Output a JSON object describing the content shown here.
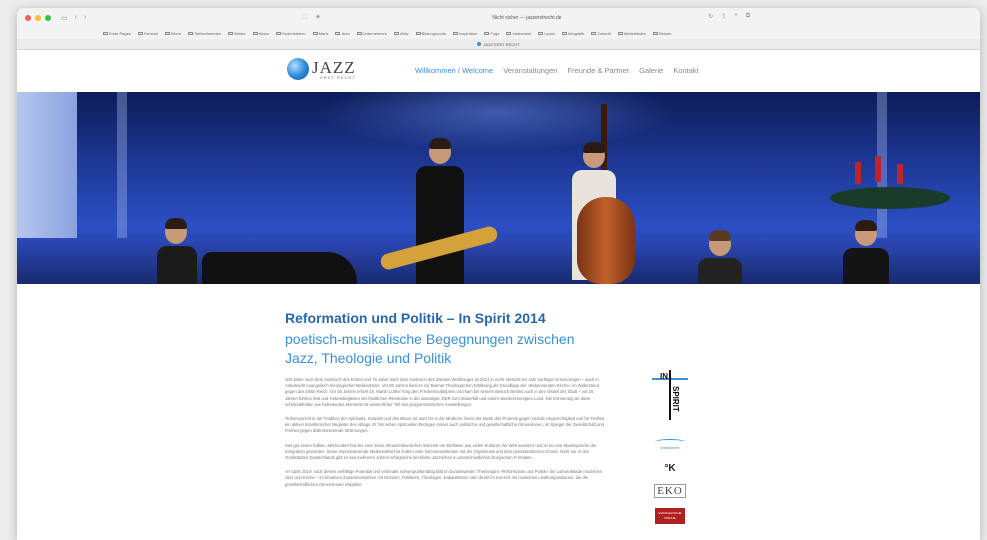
{
  "browser": {
    "address": "Nicht sicher — jazzerstrecht.de",
    "tab_title": "JAZZ ERST RECHT",
    "bookmarks": [
      "Erste Pages",
      "Fahrrad",
      "Eltern",
      "Stellenfremden",
      "Werke",
      "News",
      "Gedenkfeiern",
      "Marix",
      "Auto",
      "Unternehmen",
      "Aktiv",
      "Bildungsrouts",
      "Inspiration",
      "Fuge",
      "Instrument",
      "Lyons",
      "Infografik",
      "Zukunft",
      "Weiterbilden",
      "Reisen"
    ]
  },
  "site": {
    "logo_text": "JAZZ",
    "logo_sub": "ERST RECHT",
    "nav": [
      "Willkommen / Welcome",
      "Veranstaltungen",
      "Freunde & Partner",
      "Galerie",
      "Kontakt"
    ]
  },
  "article": {
    "title": "Reformation und Politik – In Spirit 2014",
    "subtitle": "poetisch-musikalische Begegnungen zwischen Jazz, Theologie und Politik",
    "paragraphs": [
      "100 Jahre nach dem Ausbruch des Ersten und 75 Jahre nach dem Ausbruch des Zweiten Weltkrieges ist 2014 in mehr Hinsicht ein Jahr wichtiger Erinnerungen – auch in Anbetracht evangelisch-theologischer Meilensteine. Vor 80 Jahren kam es zur Barmer Theologischen Erklärung als Grundlage der «Bekennenden Kirche» im Widerstand gegen das Dritte Reich. Vor 50 Jahren erhielt Dr. Martin Luther King den Friedensnobelpreis und kam bei seinem Besuch Berlins auch in den Ostteil der Stadt – vor 25 Jahren führten Mut und Gebetsbegleiten der friedlichen Revolution in der damaligen DDR zum Mauerfall und einem wiedervereinigten Land. Die Erinnerung an diese schicksalhaften wie befreienden Momente ist wesentlicher Teil des programmatischen Ausstellungen.",
      "Tiefverwurzelt in der Tradition der Spirituals, Gospels und des Blues, ist Jazz bis in die Moderne hinein als Musik des Protests gegen soziale Ungerechtigkeit und für Freiheit ein aktiver künstlerischer Begleiter des Alltags. Er hat neben spirituellen Bezügen immer auch politische und gesellschaftliche Dimensionen, ist Spiegel der Gesellschaft und Freiheit gegen diskriminierende Strömungen.",
      "Seit gut einem halben Jahrhundert hat der Jazz seine afroamerikanischen Wurzeln um Einflüsse aus vielen Kulturen der Welt erweitert und ist so eine Musiksprache der Integration geworden. Seine Improvisierende Musikrealität hat zudem viele Gemeinsamkeiten mit der Orgelmusik und dem protestantischen Choral. Nicht nur in den Großstädten Deutschlands gibt es seit mehreren Jahren erfolgreiche kirchliche Jazzreihen in unterschiedlichen liturgischen Formaten.",
      "›In Spirit 2014‹ nutzt dieses vielfältige Potential und verbindet schwerpunktmäßig Bild im bundesweiten Themenjahr »Reformation und Politik« der Lutherdekade modernen Jazz und Kirche – im kreativen Zusammenwirken mit Dichtern, Politikern, Theologen, Kabarettisten oder direkt im Konzert mit modernen Liedkompositionen, die die gesellschaftlichen Dimensionen religiöser"
    ]
  },
  "sponsors": {
    "inspirit_top": "IN",
    "inspirit_side": "SPIRIT",
    "kreis": "kreiskirche",
    "k_logo": "°K",
    "eko": "EKO",
    "red_logo": "EVANGELISCHE KIRCHE"
  }
}
